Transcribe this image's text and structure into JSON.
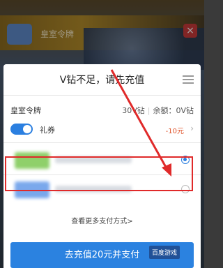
{
  "background": {
    "title": "皇室令牌",
    "close_label": "×"
  },
  "sheet": {
    "title": "V钻不足，请先充值",
    "product_name": "皇室令牌",
    "price": "30V钻",
    "balance": "余额：0V钻",
    "coupon": {
      "label": "礼券",
      "enabled": true,
      "amount": "-10元",
      "chevron": "›"
    },
    "payment_methods": [
      {
        "selected": true,
        "logo_color": "#8fd06a"
      },
      {
        "selected": false,
        "logo_color": "#7aa8ec"
      }
    ],
    "more_link": "查看更多支付方式>",
    "pay_button": "去充值20元并支付"
  },
  "colors": {
    "accent": "#2b82e0",
    "annotation_red": "#e02a2a",
    "coupon_red": "#e0552d"
  },
  "watermark": "百度游戏"
}
